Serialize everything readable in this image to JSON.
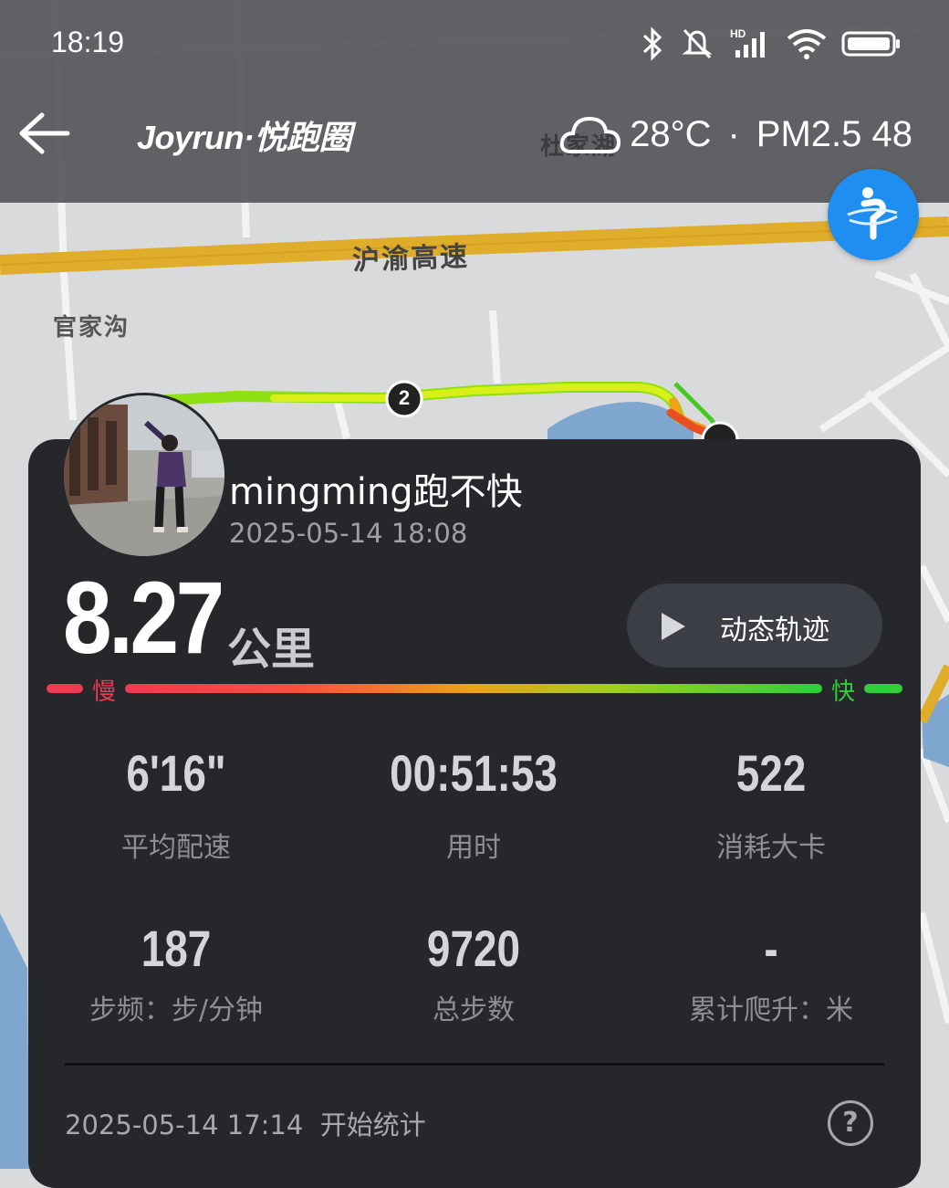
{
  "status_bar": {
    "time": "18:19"
  },
  "header": {
    "logo": "Joyrun·悦跑圈",
    "temperature": "28°C",
    "separator": "·",
    "air_quality": "PM2.5 48"
  },
  "map": {
    "road_label": "沪渝高速",
    "place_labels": [
      "官家沟",
      "杜家湖"
    ],
    "km_markers": [
      "2"
    ]
  },
  "card": {
    "username": "mingming跑不快",
    "datetime": "2025-05-14 18:08",
    "distance": "8.27",
    "distance_unit": "公里",
    "replay_button": "动态轨迹",
    "pace_slow": "慢",
    "pace_fast": "快",
    "stats": [
      {
        "value": "6'16\"",
        "label": "平均配速"
      },
      {
        "value": "00:51:53",
        "label": "用时"
      },
      {
        "value": "522",
        "label": "消耗大卡"
      },
      {
        "value": "187",
        "label": "步频：步/分钟"
      },
      {
        "value": "9720",
        "label": "总步数"
      },
      {
        "value": "-",
        "label": "累计爬升：米"
      }
    ],
    "start_info": "2025-05-14 17:14  开始统计",
    "help_symbol": "?"
  },
  "colors": {
    "accent_blue": "#1e8ff0",
    "card_bg": "#25272b",
    "pace_slow": "#ef3b52",
    "pace_fast": "#2ecf38"
  }
}
